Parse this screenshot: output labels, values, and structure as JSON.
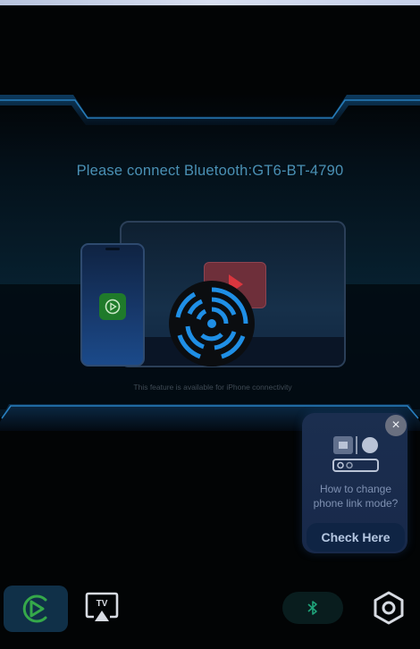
{
  "status": {
    "connect_prompt": "Please connect Bluetooth:GT6-BT-4790",
    "feature_note": "This feature is available for iPhone connectivity"
  },
  "tip_card": {
    "question": "How to change phone link mode?",
    "action_label": "Check Here",
    "close_glyph": "×"
  },
  "bottom_nav": {
    "items": [
      {
        "id": "carplay",
        "icon": "carplay-icon",
        "active": true
      },
      {
        "id": "airplay-tv",
        "icon": "airplay-tv-icon",
        "label": "TV",
        "active": false
      },
      {
        "id": "bluetooth",
        "icon": "bluetooth-icon",
        "active": false
      },
      {
        "id": "settings",
        "icon": "settings-hex-icon",
        "active": false
      }
    ]
  },
  "colors": {
    "background": "#020405",
    "accent_blue": "#1f8fe6",
    "carplay_green": "#35a84a",
    "bluetooth_green": "#1fa37a",
    "text_blue": "#4a90b4",
    "tip_card": "#1b2e4f"
  }
}
